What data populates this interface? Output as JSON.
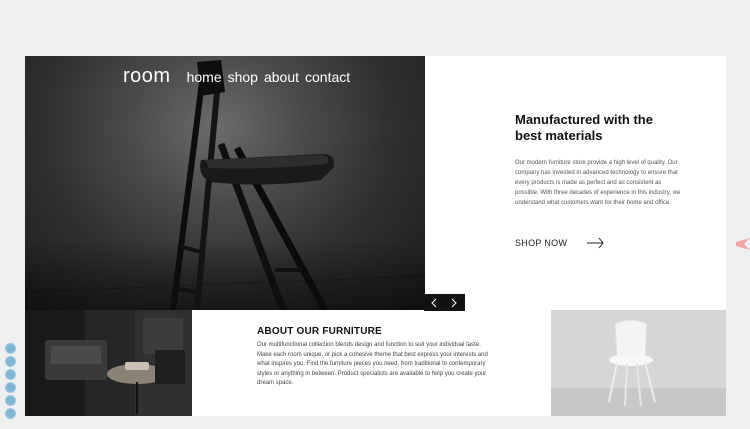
{
  "nav": {
    "brand": "room",
    "links": [
      "home",
      "shop",
      "about",
      "contact"
    ]
  },
  "hero": {
    "title_line1": "Manufactured with the",
    "title_line2": "best materials",
    "body": "Our modern furniture store provide a high level of quality. Our company has invested in advanced technology to ensure that every products is made as perfect and as consistent as possible. With three decades of experience in this industry, we understand what customers want for their home and office.",
    "cta_label": "SHOP NOW"
  },
  "about": {
    "title": "ABOUT OUR FURNITURE",
    "body": "Our multifunctional collection blends design and function to suit your individual taste. Make each room unique, or pick a cohesive theme that best express your interests and what inspires you. Find the furniture pieces you need, from traditional to contemporary styles or anything in between. Product specialists are available to help you create your dream space."
  },
  "icons": [
    "arrow-left-icon",
    "arrow-right-icon",
    "long-arrow-right-icon"
  ],
  "colors": {
    "background": "#efefef",
    "panel": "#ffffff",
    "text": "#111111",
    "slider_control": "#111111",
    "dots": "#7fb6d6",
    "accent": "#f3a6a6"
  }
}
